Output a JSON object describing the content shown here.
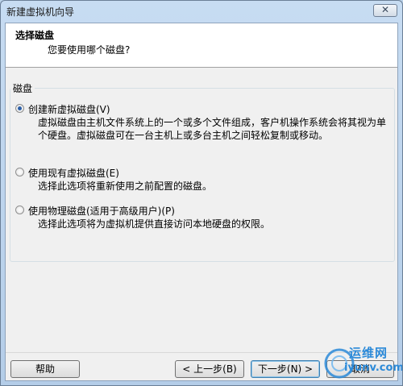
{
  "window": {
    "title": "新建虚拟机向导",
    "close_glyph": "✕"
  },
  "header": {
    "title": "选择磁盘",
    "subtitle": "您要使用哪个磁盘?"
  },
  "group": {
    "legend": "磁盘"
  },
  "options": [
    {
      "label": "创建新虚拟磁盘(V)",
      "checked": true,
      "desc": "虚拟磁盘由主机文件系统上的一个或多个文件组成，客户机操作系统会将其视为单个硬盘。虚拟磁盘可在一台主机上或多台主机之间轻松复制或移动。"
    },
    {
      "label": "使用现有虚拟磁盘(E)",
      "checked": false,
      "desc": "选择此选项将重新使用之前配置的磁盘。"
    },
    {
      "label": "使用物理磁盘(适用于高级用户)(P)",
      "checked": false,
      "desc": "选择此选项将为虚拟机提供直接访问本地硬盘的权限。"
    }
  ],
  "buttons": {
    "help": "帮助",
    "back": "< 上一步(B)",
    "next": "下一步(N) >",
    "cancel": "取消"
  },
  "watermark": {
    "line1": "运维网",
    "line2": "iyunv.com"
  }
}
